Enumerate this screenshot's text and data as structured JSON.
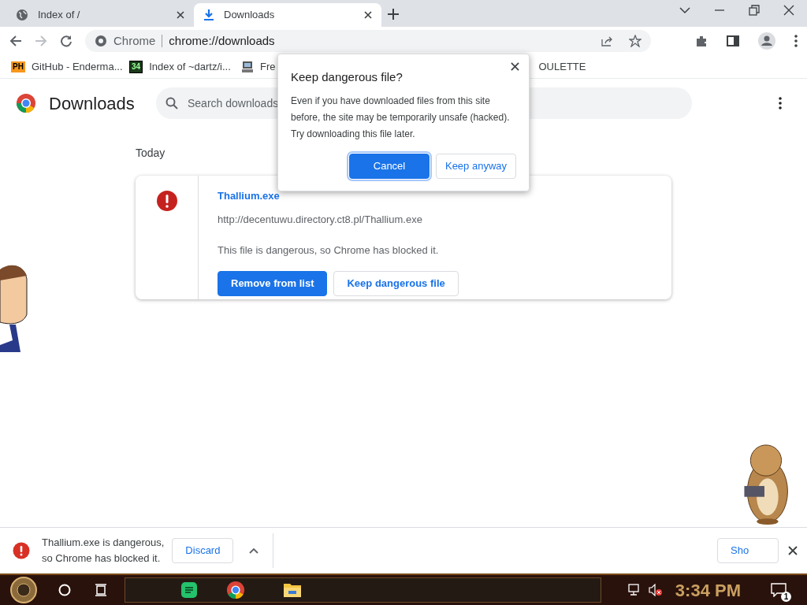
{
  "tabs": [
    {
      "title": "Index of /",
      "selected": false,
      "kind": "globe"
    },
    {
      "title": "Downloads",
      "selected": true,
      "kind": "download"
    }
  ],
  "address_bar": {
    "site_label": "Chrome",
    "url": "chrome://downloads"
  },
  "bookmarks": [
    {
      "label": "GitHub - Enderma...",
      "kind": "badge",
      "icon_text": "PH"
    },
    {
      "label": "Index of ~dartz/i...",
      "kind": "tile",
      "icon_text": "34"
    },
    {
      "label": "Fre",
      "kind": "computer"
    },
    {
      "label": "OULETTE",
      "kind": "none"
    }
  ],
  "page": {
    "title": "Downloads",
    "search_placeholder": "Search downloads",
    "section": "Today"
  },
  "download_item": {
    "file_name": "Thallium.exe",
    "url": "http://decentuwu.directory.ct8.pl/Thallium.exe",
    "status": "This file is dangerous, so Chrome has blocked it.",
    "buttons": [
      {
        "label": "Remove from list",
        "primary": true
      },
      {
        "label": "Keep dangerous file",
        "primary": false
      }
    ]
  },
  "dialog": {
    "title": "Keep dangerous file?",
    "body": "Even if you have downloaded files from this site before, the site may be temporarily unsafe (hacked). Try downloading this file later.",
    "buttons": [
      {
        "label": "Cancel",
        "primary": true
      },
      {
        "label": "Keep anyway",
        "primary": false
      }
    ]
  },
  "shelf": {
    "message_lines": [
      "Thallium.exe is dangerous,",
      "so Chrome has blocked it."
    ],
    "discard": "Discard",
    "show_all": "Sho"
  },
  "taskbar": {
    "time": "3:34 PM",
    "notifications": "1"
  }
}
